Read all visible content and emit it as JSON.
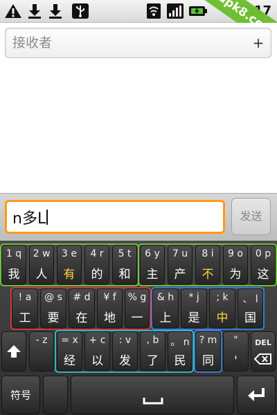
{
  "status_bar": {
    "time": "4:17",
    "icons": [
      "warning-icon",
      "download-icon",
      "download-icon",
      "usb-icon",
      "wifi-icon",
      "signal-icon",
      "battery-charging-icon"
    ],
    "watermark": "apk8.com"
  },
  "recipient": {
    "placeholder": "接收者"
  },
  "compose": {
    "message_value": "n多L",
    "send_label": "发送"
  },
  "keyboard": {
    "row1": [
      {
        "top": "1 q",
        "bottom": "我",
        "highlight": false
      },
      {
        "top": "2 w",
        "bottom": "人",
        "highlight": false
      },
      {
        "top": "3 e",
        "bottom": "有",
        "highlight": true
      },
      {
        "top": "4 r",
        "bottom": "的",
        "highlight": false
      },
      {
        "top": "5 t",
        "bottom": "和",
        "highlight": false
      },
      {
        "top": "6 y",
        "bottom": "主",
        "highlight": false
      },
      {
        "top": "7 u",
        "bottom": "产",
        "highlight": false
      },
      {
        "top": "8 i",
        "bottom": "不",
        "highlight": true
      },
      {
        "top": "9 o",
        "bottom": "为",
        "highlight": false
      },
      {
        "top": "0 p",
        "bottom": "这",
        "highlight": false
      }
    ],
    "row2": [
      {
        "top": "! a",
        "bottom": "工",
        "highlight": false
      },
      {
        "top": "@ s",
        "bottom": "要",
        "highlight": false
      },
      {
        "top": "# d",
        "bottom": "在",
        "highlight": false
      },
      {
        "top": "¥ f",
        "bottom": "地",
        "highlight": false
      },
      {
        "top": "% g",
        "bottom": "一",
        "highlight": false
      },
      {
        "top": "& h",
        "bottom": "上",
        "highlight": false
      },
      {
        "top": "* j",
        "bottom": "是",
        "highlight": false
      },
      {
        "top": "; k",
        "bottom": "中",
        "highlight": true
      },
      {
        "top": "、 l",
        "bottom": "国",
        "highlight": false
      }
    ],
    "row3": [
      {
        "top": "- z",
        "bottom": "",
        "highlight": false
      },
      {
        "top": "= x",
        "bottom": "经",
        "highlight": false
      },
      {
        "top": "+ c",
        "bottom": "以",
        "highlight": false
      },
      {
        "top": ": v",
        "bottom": "发",
        "highlight": false
      },
      {
        "top": ", b",
        "bottom": "了",
        "highlight": false
      },
      {
        "top": "。 n",
        "bottom": "民",
        "highlight": false
      },
      {
        "top": "? m",
        "bottom": "同",
        "highlight": false
      },
      {
        "top": "\"",
        "bottom": "'",
        "highlight": false
      }
    ],
    "del_label": "DEL",
    "symbols_label": "符号"
  },
  "colors": {
    "group_green": "#6cc23a",
    "group_red": "#d23a3a",
    "group_blue": "#3d7bd6",
    "group_cyan": "#34b3c4",
    "focus_orange": "#ff9a12",
    "highlight_yellow": "#ffd53b"
  }
}
